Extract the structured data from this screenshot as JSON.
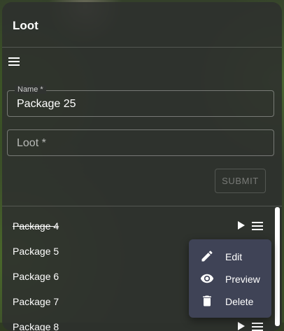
{
  "panel": {
    "title": "Loot"
  },
  "form": {
    "name_label": "Name *",
    "name_value": "Package 25",
    "loot_placeholder": "Loot *",
    "submit_label": "SUBMIT"
  },
  "list": {
    "items": [
      {
        "label": "Package 4",
        "completed": true
      },
      {
        "label": "Package 5"
      },
      {
        "label": "Package 6"
      },
      {
        "label": "Package 7"
      },
      {
        "label": "Package 8"
      }
    ]
  },
  "context_menu": {
    "items": [
      {
        "label": "Edit",
        "icon": "pencil-icon"
      },
      {
        "label": "Preview",
        "icon": "eye-icon"
      },
      {
        "label": "Delete",
        "icon": "trash-icon"
      }
    ]
  }
}
